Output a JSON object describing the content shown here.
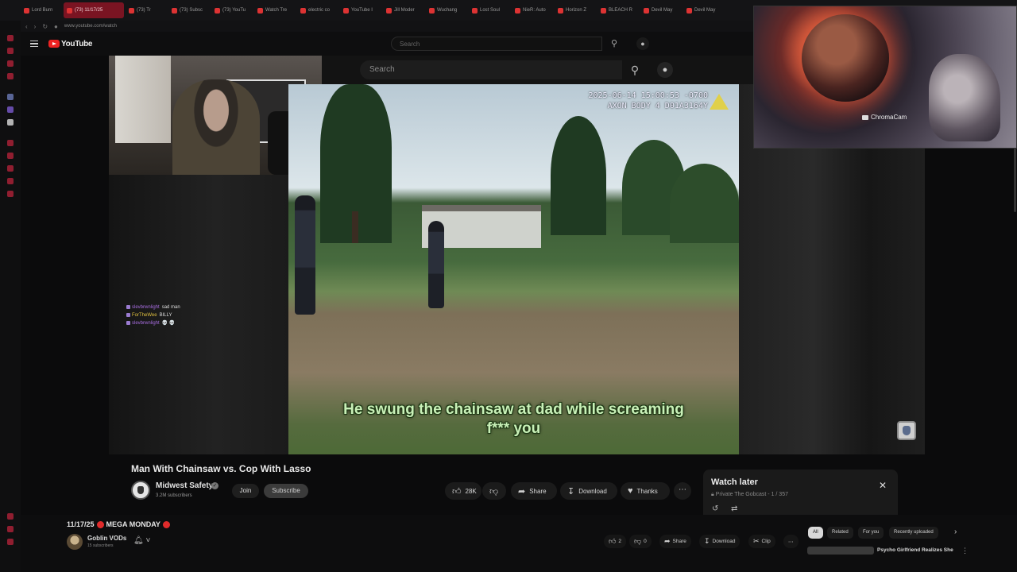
{
  "browser": {
    "tabs": [
      {
        "label": "Lord Burn"
      },
      {
        "label": "(73) 11/17/25"
      },
      {
        "label": "(73) Tr"
      },
      {
        "label": "(73) Subsc"
      },
      {
        "label": "(73) YouTu"
      },
      {
        "label": "Watch Tre"
      },
      {
        "label": "electric co"
      },
      {
        "label": "YouTube I"
      },
      {
        "label": "Jill Moder"
      },
      {
        "label": "Wuchang"
      },
      {
        "label": "Lost Soul"
      },
      {
        "label": "NieR: Auto"
      },
      {
        "label": "Horizon Z"
      },
      {
        "label": "BLEACH R"
      },
      {
        "label": "Devil May"
      },
      {
        "label": "Devil May"
      }
    ],
    "url": "www.youtube.com/watch"
  },
  "header": {
    "brand": "YouTube",
    "search_placeholder": "Search",
    "search_placeholder_overlay": "Search"
  },
  "video": {
    "bodycam_stamp_line1": "2025-06-14 15:00:53 -0700",
    "bodycam_stamp_line2": "AXON BODY 4 D01A3164Y",
    "subtitle": "He swung the chainsaw at dad while screaming f*** you",
    "title": "Man With Chainsaw vs. Cop With Lasso"
  },
  "chat": [
    {
      "user": "slevbrwnlight",
      "message": "sad man"
    },
    {
      "user": "ForTheWee",
      "message": "BILLY"
    },
    {
      "user": "slevbrwnlight",
      "message": "💀 💀"
    }
  ],
  "overlay_cam": {
    "label": "ChromaCam"
  },
  "channel": {
    "name": "Midwest Safety",
    "subscribers": "3.2M subscribers",
    "join": "Join",
    "subscribe": "Subscribe"
  },
  "actions": {
    "likes": "28K",
    "share": "Share",
    "download": "Download",
    "thanks": "Thanks"
  },
  "watch_later": {
    "title": "Watch later",
    "subtitle": "Private The Gobcast - 1 / 357"
  },
  "stream": {
    "title": "11/17/25",
    "title_suffix": "MEGA MONDAY",
    "channel": "Goblin VODs",
    "subscribers": "15 subscribers",
    "likes": "2",
    "dislikes": "0",
    "share": "Share",
    "download": "Download",
    "clip": "Clip"
  },
  "chips": [
    "All",
    "Related",
    "For you",
    "Recently uploaded"
  ],
  "related": {
    "title": "Psycho Girlfriend Realizes She"
  },
  "colors": {
    "accent": "#e02b2b",
    "browser_accent": "#b02238",
    "subtitle": "#c9f0b8"
  }
}
